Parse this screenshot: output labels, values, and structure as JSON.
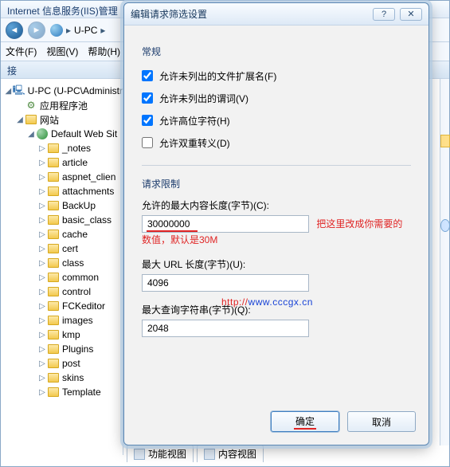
{
  "main": {
    "title": "Internet 信息服务(IIS)管理",
    "breadcrumb_host": "U-PC"
  },
  "menu": {
    "file": "文件(F)",
    "view": "视图(V)",
    "help": "帮助(H)"
  },
  "left_header": "接",
  "tree": {
    "host": "U-PC (U-PC\\Administr",
    "appPools": "应用程序池",
    "sites": "网站",
    "defaultSite": "Default Web Sit",
    "folders": [
      "_notes",
      "article",
      "aspnet_clien",
      "attachments",
      "BackUp",
      "basic_class",
      "cache",
      "cert",
      "class",
      "common",
      "control",
      "FCKeditor",
      "images",
      "kmp",
      "Plugins",
      "post",
      "skins",
      "Template"
    ]
  },
  "dialog": {
    "title": "编辑请求筛选设置",
    "section_general": "常规",
    "chk_ext": "允许未列出的文件扩展名(F)",
    "chk_verb": "允许未列出的谓词(V)",
    "chk_highbit": "允许高位字符(H)",
    "chk_double": "允许双重转义(D)",
    "section_limits": "请求限制",
    "lbl_maxcontent": "允许的最大内容长度(字节)(C):",
    "val_maxcontent": "30000000",
    "note": "把这里改成你需要的数值，默认是30M",
    "lbl_maxurl": "最大 URL 长度(字节)(U):",
    "val_maxurl": "4096",
    "lbl_maxquery": "最大查询字符串(字节)(Q):",
    "val_maxquery": "2048",
    "btn_ok": "确定",
    "btn_cancel": "取消",
    "checked": {
      "ext": true,
      "verb": true,
      "highbit": true,
      "double": false
    }
  },
  "watermark": {
    "pre": "http://",
    "url": "www.cccgx.cn"
  },
  "bottom_tabs": {
    "features": "功能视图",
    "content": "内容视图"
  }
}
